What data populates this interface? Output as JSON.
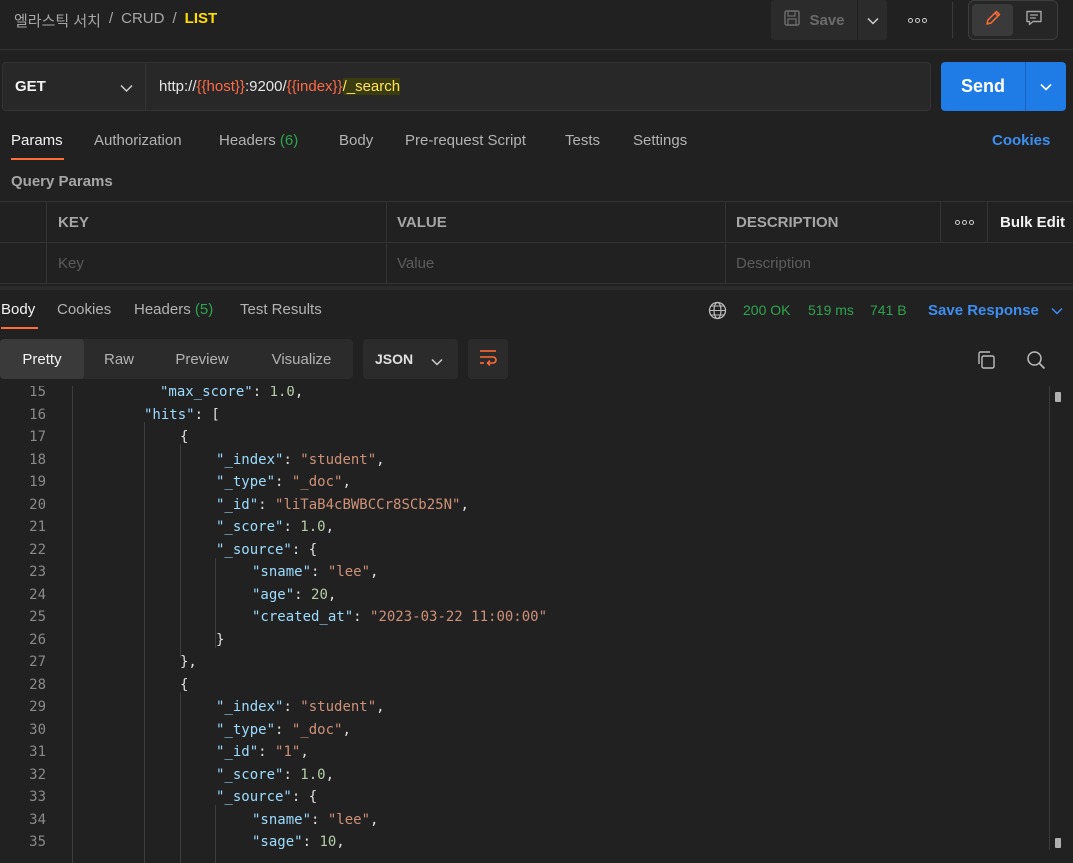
{
  "header": {
    "breadcrumb": [
      "엘라스틱 서치",
      "CRUD",
      "LIST"
    ],
    "save_label": "Save"
  },
  "request": {
    "method": "GET",
    "url_parts": [
      "http://",
      "{{host}}",
      ":9200/",
      "{{index}}",
      "/_search"
    ],
    "send_label": "Send"
  },
  "request_tabs": [
    {
      "label": "Params",
      "count": ""
    },
    {
      "label": "Authorization",
      "count": ""
    },
    {
      "label": "Headers",
      "count": "(6)"
    },
    {
      "label": "Body",
      "count": ""
    },
    {
      "label": "Pre-request Script",
      "count": ""
    },
    {
      "label": "Tests",
      "count": ""
    },
    {
      "label": "Settings",
      "count": ""
    }
  ],
  "cookies_link": "Cookies",
  "query_params": {
    "title": "Query Params",
    "columns": [
      "KEY",
      "VALUE",
      "DESCRIPTION"
    ],
    "bulk_edit": "Bulk Edit",
    "placeholders": [
      "Key",
      "Value",
      "Description"
    ]
  },
  "response_tabs": [
    {
      "label": "Body",
      "count": ""
    },
    {
      "label": "Cookies",
      "count": ""
    },
    {
      "label": "Headers",
      "count": "(5)"
    },
    {
      "label": "Test Results",
      "count": ""
    }
  ],
  "response_status": {
    "status": "200 OK",
    "time": "519 ms",
    "size": "741 B",
    "save_response": "Save Response"
  },
  "format_tabs": [
    "Pretty",
    "Raw",
    "Preview",
    "Visualize"
  ],
  "format_select": "JSON",
  "code_lines": [
    {
      "n": "15",
      "indent": 0,
      "t": [
        [
          "k",
          "\"max_score\""
        ],
        [
          "p",
          ": "
        ],
        [
          "n",
          "1.0"
        ],
        [
          "p",
          ","
        ]
      ]
    },
    {
      "n": "16",
      "indent": 1,
      "t": [
        [
          "k",
          "\"hits\""
        ],
        [
          "p",
          ": ["
        ]
      ]
    },
    {
      "n": "17",
      "indent": 2,
      "t": [
        [
          "p",
          "{"
        ]
      ]
    },
    {
      "n": "18",
      "indent": 3,
      "t": [
        [
          "k",
          "\"_index\""
        ],
        [
          "p",
          ": "
        ],
        [
          "s",
          "\"student\""
        ],
        [
          "p",
          ","
        ]
      ]
    },
    {
      "n": "19",
      "indent": 3,
      "t": [
        [
          "k",
          "\"_type\""
        ],
        [
          "p",
          ": "
        ],
        [
          "s",
          "\"_doc\""
        ],
        [
          "p",
          ","
        ]
      ]
    },
    {
      "n": "20",
      "indent": 3,
      "t": [
        [
          "k",
          "\"_id\""
        ],
        [
          "p",
          ": "
        ],
        [
          "s",
          "\"liTaB4cBWBCCr8SCb25N\""
        ],
        [
          "p",
          ","
        ]
      ]
    },
    {
      "n": "21",
      "indent": 3,
      "t": [
        [
          "k",
          "\"_score\""
        ],
        [
          "p",
          ": "
        ],
        [
          "n",
          "1.0"
        ],
        [
          "p",
          ","
        ]
      ]
    },
    {
      "n": "22",
      "indent": 3,
      "t": [
        [
          "k",
          "\"_source\""
        ],
        [
          "p",
          ": {"
        ]
      ]
    },
    {
      "n": "23",
      "indent": 4,
      "t": [
        [
          "k",
          "\"sname\""
        ],
        [
          "p",
          ": "
        ],
        [
          "s",
          "\"lee\""
        ],
        [
          "p",
          ","
        ]
      ]
    },
    {
      "n": "24",
      "indent": 4,
      "t": [
        [
          "k",
          "\"age\""
        ],
        [
          "p",
          ": "
        ],
        [
          "n",
          "20"
        ],
        [
          "p",
          ","
        ]
      ]
    },
    {
      "n": "25",
      "indent": 4,
      "t": [
        [
          "k",
          "\"created_at\""
        ],
        [
          "p",
          ": "
        ],
        [
          "s",
          "\"2023-03-22 11:00:00\""
        ]
      ]
    },
    {
      "n": "26",
      "indent": 3,
      "t": [
        [
          "p",
          "}"
        ]
      ]
    },
    {
      "n": "27",
      "indent": 2,
      "t": [
        [
          "p",
          "},"
        ]
      ]
    },
    {
      "n": "28",
      "indent": 2,
      "t": [
        [
          "p",
          "{"
        ]
      ]
    },
    {
      "n": "29",
      "indent": 3,
      "t": [
        [
          "k",
          "\"_index\""
        ],
        [
          "p",
          ": "
        ],
        [
          "s",
          "\"student\""
        ],
        [
          "p",
          ","
        ]
      ]
    },
    {
      "n": "30",
      "indent": 3,
      "t": [
        [
          "k",
          "\"_type\""
        ],
        [
          "p",
          ": "
        ],
        [
          "s",
          "\"_doc\""
        ],
        [
          "p",
          ","
        ]
      ]
    },
    {
      "n": "31",
      "indent": 3,
      "t": [
        [
          "k",
          "\"_id\""
        ],
        [
          "p",
          ": "
        ],
        [
          "s",
          "\"1\""
        ],
        [
          "p",
          ","
        ]
      ]
    },
    {
      "n": "32",
      "indent": 3,
      "t": [
        [
          "k",
          "\"_score\""
        ],
        [
          "p",
          ": "
        ],
        [
          "n",
          "1.0"
        ],
        [
          "p",
          ","
        ]
      ]
    },
    {
      "n": "33",
      "indent": 3,
      "t": [
        [
          "k",
          "\"_source\""
        ],
        [
          "p",
          ": {"
        ]
      ]
    },
    {
      "n": "34",
      "indent": 4,
      "t": [
        [
          "k",
          "\"sname\""
        ],
        [
          "p",
          ": "
        ],
        [
          "s",
          "\"lee\""
        ],
        [
          "p",
          ","
        ]
      ]
    },
    {
      "n": "35",
      "indent": 4,
      "t": [
        [
          "k",
          "\"sage\""
        ],
        [
          "p",
          ": "
        ],
        [
          "n",
          "10"
        ],
        [
          "p",
          ","
        ]
      ]
    }
  ],
  "colors": {
    "accent": "#ff6c37",
    "send_blue": "#1f7ce6",
    "link_blue": "#3d8ef0",
    "status_green": "#2ea44f",
    "breadcrumb_current": "#ffdd00"
  }
}
